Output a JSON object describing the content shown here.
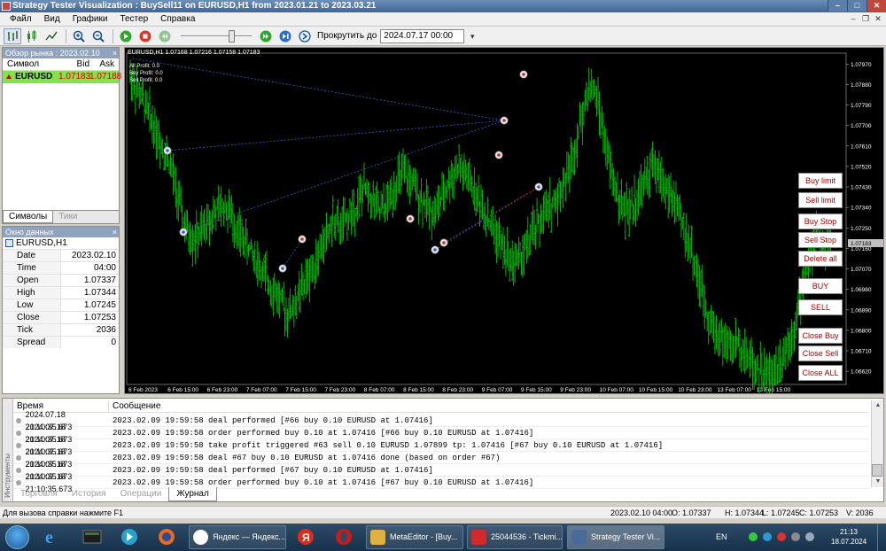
{
  "window": {
    "title": "Strategy Tester Visualization : BuySell11 on EURUSD,H1 from 2023.01.21 to 2023.03.21",
    "buttons": [
      "–",
      "□",
      "✕"
    ]
  },
  "menu": [
    "Файл",
    "Вид",
    "Графики",
    "Тестер",
    "Справка"
  ],
  "mdi_buttons": [
    "–",
    "❐",
    "✕"
  ],
  "toolbar": {
    "scroll_to_label": "Прокрутить до",
    "scroll_to_value": "2024.07.17 00:00",
    "slider_level": 0.7
  },
  "market_watch": {
    "title": "Обзор рынка : 2023.02.10",
    "columns": [
      "Символ",
      "Bid",
      "Ask"
    ],
    "rows": [
      {
        "symbol": "EURUSD",
        "bid": "1.07183",
        "ask": "1.07188"
      }
    ],
    "tabs": [
      "Символы",
      "Тики"
    ]
  },
  "data_window": {
    "title": "Окно данных",
    "symbol": "EURUSD,H1",
    "rows": [
      {
        "k": "Date",
        "v": "2023.02.10"
      },
      {
        "k": "Time",
        "v": "04:00"
      },
      {
        "k": "Open",
        "v": "1.07337"
      },
      {
        "k": "High",
        "v": "1.07344"
      },
      {
        "k": "Low",
        "v": "1.07245"
      },
      {
        "k": "Close",
        "v": "1.07253"
      },
      {
        "k": "Tick Volume",
        "v": "2036"
      },
      {
        "k": "Spread",
        "v": "0"
      }
    ]
  },
  "chart": {
    "title": "EURUSD,H1  1.07168  1.07216  1.07158  1.07183",
    "info": [
      "All Profit: 0.0",
      "Buy Profit: 0.0",
      "Sell Profit: 0.0"
    ],
    "price_labels": [
      "1.07970",
      "1.07880",
      "1.07790",
      "1.07700",
      "1.07610",
      "1.07520",
      "1.07430",
      "1.07340",
      "1.07250",
      "1.07160",
      "1.07070",
      "1.06980",
      "1.06890",
      "1.06800",
      "1.06710",
      "1.06620"
    ],
    "current_price": "1.07183",
    "time_labels": [
      "6 Feb 2023",
      "6 Feb 15:00",
      "6 Feb 23:00",
      "7 Feb 07:00",
      "7 Feb 15:00",
      "7 Feb 23:00",
      "8 Feb 07:00",
      "8 Feb 15:00",
      "8 Feb 23:00",
      "9 Feb 07:00",
      "9 Feb 15:00",
      "9 Feb 23:00",
      "10 Feb 07:00",
      "10 Feb 15:00",
      "10 Feb 23:00",
      "13 Feb 07:00",
      "13 Feb 15:00"
    ],
    "buttons": [
      "Buy limit",
      "Sell limit",
      "Buy Stop",
      "Sell Stop",
      "Delete all",
      "BUY",
      "SELL",
      "Close Buy",
      "Close Sell",
      "Close ALL"
    ],
    "colors": {
      "bars": "#00c800",
      "background": "#000000",
      "grid": "#556655",
      "buy_line": "#3060d0",
      "sell_line": "#c03030",
      "button_text": "#b00000"
    }
  },
  "chart_data": {
    "type": "bar",
    "symbol": "EURUSD",
    "timeframe": "H1",
    "ylim": [
      1.0657,
      1.0801
    ],
    "x_range": [
      "6 Feb 2023",
      "13 Feb 19:00"
    ],
    "close_series": [
      1.0792,
      1.0785,
      1.0778,
      1.077,
      1.0762,
      1.0755,
      1.074,
      1.0725,
      1.072,
      1.0722,
      1.0728,
      1.0732,
      1.0735,
      1.073,
      1.0722,
      1.0718,
      1.0712,
      1.0705,
      1.07,
      1.0695,
      1.0688,
      1.069,
      1.0698,
      1.0705,
      1.0712,
      1.072,
      1.0728,
      1.0725,
      1.073,
      1.0735,
      1.0742,
      1.0738,
      1.0732,
      1.0736,
      1.0744,
      1.0748,
      1.0745,
      1.074,
      1.0735,
      1.0732,
      1.0738,
      1.0746,
      1.0752,
      1.0748,
      1.0742,
      1.0735,
      1.0728,
      1.0722,
      1.0715,
      1.071,
      1.0712,
      1.0718,
      1.0725,
      1.073,
      1.0735,
      1.074,
      1.0748,
      1.076,
      1.0775,
      1.0788,
      1.078,
      1.076,
      1.0745,
      1.0735,
      1.0732,
      1.0738,
      1.0745,
      1.0752,
      1.0748,
      1.074,
      1.0735,
      1.0725,
      1.0715,
      1.07,
      1.0688,
      1.068,
      1.0676,
      1.0672,
      1.0675,
      1.067,
      1.0665,
      1.0662,
      1.066,
      1.0664,
      1.0672,
      1.068,
      1.0695,
      1.0712,
      1.0722,
      1.0718
    ]
  },
  "journal": {
    "side_label": "Инструменты",
    "columns": [
      "Время",
      "Сообщение"
    ],
    "rows": [
      {
        "time": "2024.07.18 21:10:35.673",
        "msg": "2023.02.09 19:59:58   deal performed [#66 buy 0.10 EURUSD at 1.07416]"
      },
      {
        "time": "2024.07.18 21:10:35.673",
        "msg": "2023.02.09 19:59:58   order performed buy 0.10 at 1.07416 [#66 buy 0.10 EURUSD at 1.07416]"
      },
      {
        "time": "2024.07.18 21:10:35.673",
        "msg": "2023.02.09 19:59:58   take profit triggered #63 sell 0.10 EURUSD 1.07899 tp: 1.07416 [#67 buy 0.10 EURUSD at 1.07416]"
      },
      {
        "time": "2024.07.18 21:10:35.673",
        "msg": "2023.02.09 19:59:58   deal #67 buy 0.10 EURUSD at 1.07416 done (based on order #67)"
      },
      {
        "time": "2024.07.18 21:10:35.673",
        "msg": "2023.02.09 19:59:58   deal performed [#67 buy 0.10 EURUSD at 1.07416]"
      },
      {
        "time": "2024.07.18 21:10:35.673",
        "msg": "2023.02.09 19:59:58   order performed buy 0.10 at 1.07416 [#67 buy 0.10 EURUSD at 1.07416]"
      }
    ],
    "tabs": [
      "Торговля",
      "История",
      "Операции",
      "Журнал"
    ]
  },
  "statusbar": {
    "hint": "Для вызова справки нажмите F1",
    "datetime": "2023.02.10 04:00",
    "open": "O: 1.07337",
    "high": "H: 1.07344",
    "low": "L: 1.07245",
    "close": "C: 1.07253",
    "volume": "V: 2036"
  },
  "taskbar": {
    "tasks": [
      "Яндекс — Яндекс...",
      "MetaEditor - [Buy...",
      "25044536 - Tickmi...",
      "Strategy Tester Vi..."
    ],
    "lang": "EN",
    "time": "21:13",
    "date": "18.07.2024"
  }
}
